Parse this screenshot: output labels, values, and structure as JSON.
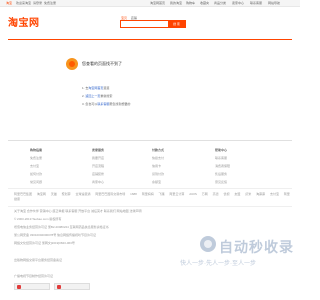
{
  "topbar": {
    "brand": "淘宝",
    "welcome": "欢迎来淘宝",
    "login": "请登录",
    "register": "免费注册",
    "nav": [
      "淘宝网首页",
      "我的淘宝",
      "购物车",
      "收藏夹",
      "商品分类",
      "卖家中心",
      "联系客服",
      "网站导航"
    ]
  },
  "header": {
    "logo_text": "淘宝网",
    "search_tabs": [
      "宝贝",
      "店铺"
    ],
    "search_placeholder": "",
    "search_button": "搜 索"
  },
  "error": {
    "title": "您查看的页面找不到了",
    "line1_prefix": "1. 去",
    "line1_link": "淘宝网首页",
    "line1_suffix": "逛逛",
    "line2_prefix": "2. ",
    "line2_link": "返回上一页",
    "line2_suffix": "重新搜索",
    "line3_prefix": "3. 您也可以",
    "line3_link": "联系客服",
    "line3_suffix": "帮您找到想要的"
  },
  "footer": {
    "columns": [
      {
        "heading": "购物指南",
        "items": [
          "免费注册",
          "支付宝",
          "如何付款",
          "常见问题"
        ]
      },
      {
        "heading": "卖家服务",
        "items": [
          "我要开店",
          "开店流程",
          "店铺装修",
          "商家中心"
        ]
      },
      {
        "heading": "付款方式",
        "items": [
          "快捷支付",
          "信用卡",
          "货到付款",
          "余额宝"
        ]
      },
      {
        "heading": "帮助中心",
        "items": [
          "联系客服",
          "消费者保障",
          "售后服务",
          "意见反馈"
        ]
      }
    ],
    "links": [
      "阿里巴巴集团",
      "淘宝网",
      "天猫",
      "聚划算",
      "全球速卖通",
      "阿里巴巴国际交易市场",
      "1688",
      "阿里妈妈",
      "飞猪",
      "阿里云计算",
      "AliOS",
      "万网",
      "高德",
      "优视",
      "友盟",
      "虾米",
      "淘票票",
      "支付宝",
      "阿里健康"
    ],
    "legal": [
      "关于淘宝 合作伙伴 营销中心 廉正举报 联系客服 开放平台 诚征英才 联系我们 网站地图 法律声明",
      "© 2003-2019 Taobao.com 版权所有",
      "增值电信业务经营许可证 浙B2-20080224 互联网药品信息服务资格证书",
      "浙公网安备 33010002000078号 信息网络传播视听节目许可证",
      "网络文化经营许可证 浙网文[2019]0843-063号",
      "出版物网络交易平台服务经营备案证",
      "广播电视节目制作经营许可证"
    ]
  },
  "watermark": {
    "title": "自动秒收录",
    "subtitle": "快人一步·先人一步·至人一步"
  },
  "colors": {
    "accent": "#ff4400",
    "link": "#3366cc",
    "watermark": "#b9c6d8"
  }
}
